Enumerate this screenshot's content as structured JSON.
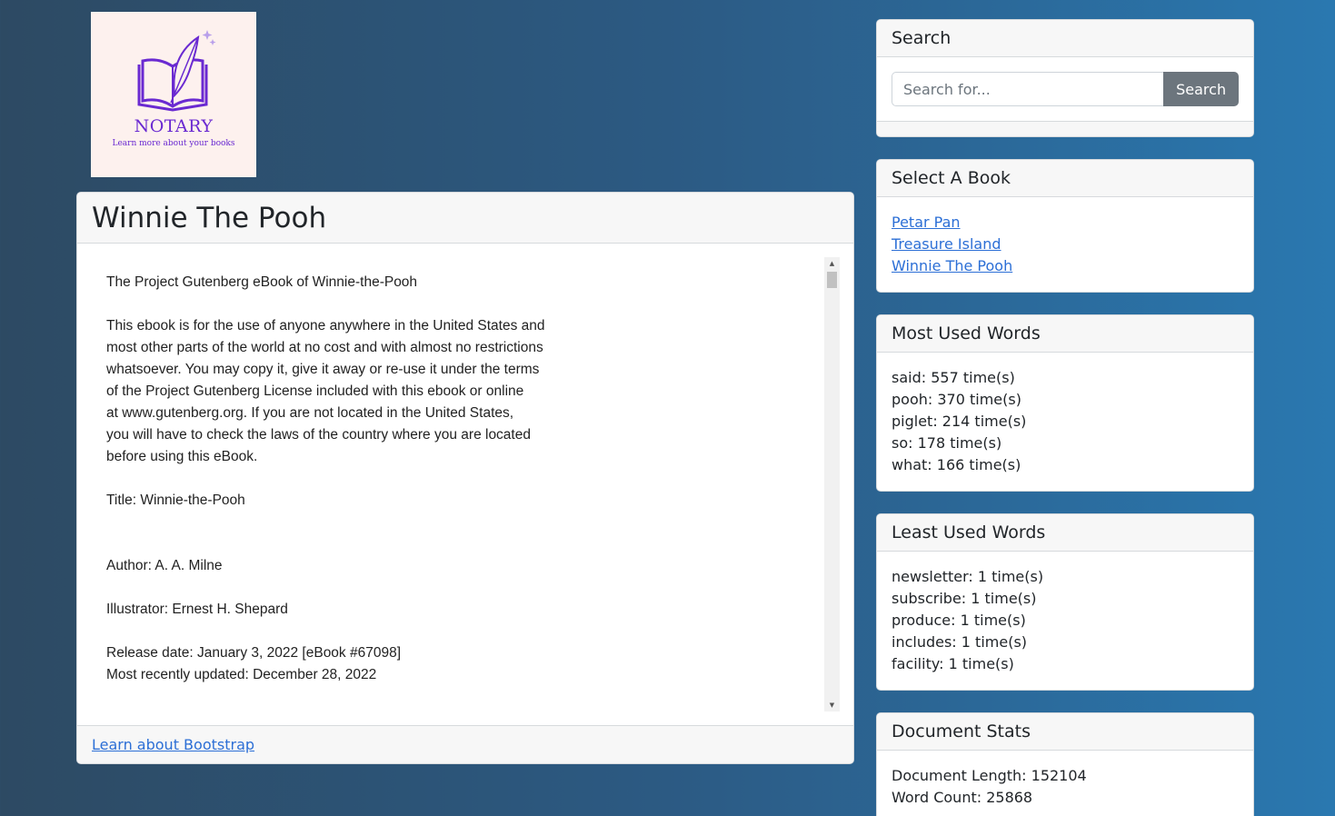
{
  "logo": {
    "title": "NOTARY",
    "subtitle": "Learn more about your books"
  },
  "main": {
    "title": "Winnie The Pooh",
    "book_text": "The Project Gutenberg eBook of Winnie-the-Pooh\n\nThis ebook is for the use of anyone anywhere in the United States and\nmost other parts of the world at no cost and with almost no restrictions\nwhatsoever. You may copy it, give it away or re-use it under the terms\nof the Project Gutenberg License included with this ebook or online\nat www.gutenberg.org. If you are not located in the United States,\nyou will have to check the laws of the country where you are located\nbefore using this eBook.\n\nTitle: Winnie-the-Pooh\n\n\nAuthor: A. A. Milne\n\nIllustrator: Ernest H. Shepard\n\nRelease date: January 3, 2022 [eBook #67098]\nMost recently updated: December 28, 2022",
    "footer_link": "Learn about Bootstrap"
  },
  "search": {
    "title": "Search",
    "placeholder": "Search for...",
    "button_label": "Search"
  },
  "books": {
    "title": "Select A Book",
    "items": [
      "Petar Pan",
      "Treasure Island",
      "Winnie The Pooh"
    ]
  },
  "most_used": {
    "title": "Most Used Words",
    "items": [
      "said: 557 time(s)",
      "pooh: 370 time(s)",
      "piglet: 214 time(s)",
      "so: 178 time(s)",
      "what: 166 time(s)"
    ]
  },
  "least_used": {
    "title": "Least Used Words",
    "items": [
      "newsletter: 1 time(s)",
      "subscribe: 1 time(s)",
      "produce: 1 time(s)",
      "includes: 1 time(s)",
      "facility: 1 time(s)"
    ]
  },
  "stats": {
    "title": "Document Stats",
    "items": [
      "Document Length: 152104",
      "Word Count: 25868"
    ]
  },
  "colors": {
    "link": "#2c6fd6",
    "button": "#6c757d",
    "logo_accent": "#6a2ad1"
  }
}
